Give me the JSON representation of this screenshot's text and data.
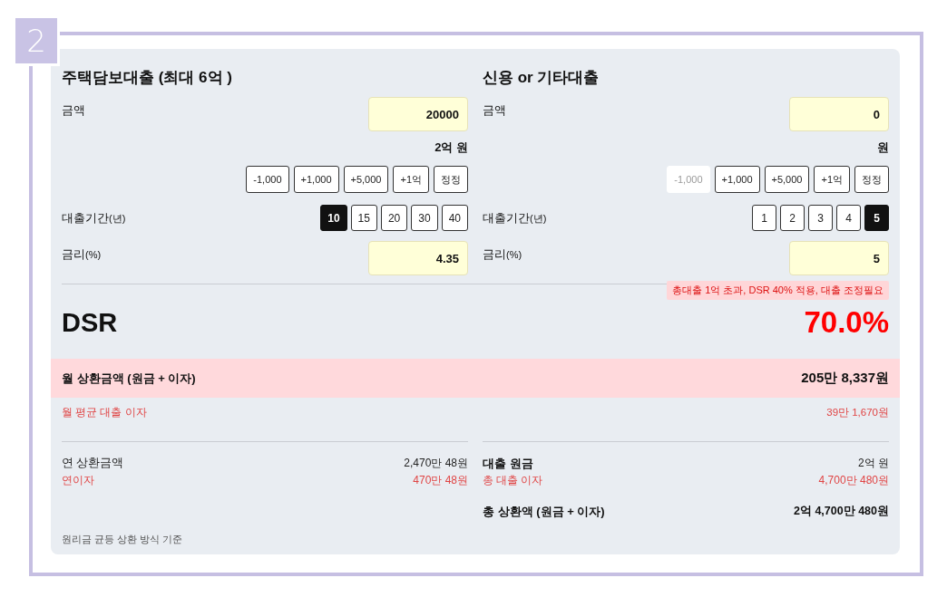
{
  "step_badge": "2",
  "loans": [
    {
      "title": "주택담보대출 (최대 6억 )",
      "amount": {
        "label": "금액",
        "value": "20000",
        "display": "2억 원"
      },
      "adjust_buttons": [
        {
          "label": "-1,000",
          "disabled": false
        },
        {
          "label": "+1,000",
          "disabled": false
        },
        {
          "label": "+5,000",
          "disabled": false
        },
        {
          "label": "+1억",
          "disabled": false
        },
        {
          "label": "정정",
          "disabled": false
        }
      ],
      "term": {
        "label": "대출기간",
        "unit": "(년)",
        "options": [
          {
            "label": "10",
            "selected": true
          },
          {
            "label": "15",
            "selected": false
          },
          {
            "label": "20",
            "selected": false
          },
          {
            "label": "30",
            "selected": false
          },
          {
            "label": "40",
            "selected": false
          }
        ]
      },
      "rate": {
        "label": "금리",
        "unit": "(%)",
        "value": "4.35"
      }
    },
    {
      "title": "신용 or 기타대출",
      "amount": {
        "label": "금액",
        "value": "0",
        "display": "원"
      },
      "adjust_buttons": [
        {
          "label": "-1,000",
          "disabled": true
        },
        {
          "label": "+1,000",
          "disabled": false
        },
        {
          "label": "+5,000",
          "disabled": false
        },
        {
          "label": "+1억",
          "disabled": false
        },
        {
          "label": "정정",
          "disabled": false
        }
      ],
      "term": {
        "label": "대출기간",
        "unit": "(년)",
        "options": [
          {
            "label": "1",
            "selected": false
          },
          {
            "label": "2",
            "selected": false
          },
          {
            "label": "3",
            "selected": false
          },
          {
            "label": "4",
            "selected": false
          },
          {
            "label": "5",
            "selected": true
          }
        ]
      },
      "rate": {
        "label": "금리",
        "unit": "(%)",
        "value": "5"
      }
    }
  ],
  "warning": "총대출 1억 초과, DSR 40% 적용, 대출 조정필요",
  "dsr": {
    "label": "DSR",
    "value": "70.0%"
  },
  "monthly_payment": {
    "label": "월 상환금액 (원금 + 이자)",
    "value": "205만 8,337원"
  },
  "monthly_interest": {
    "label": "월 평균 대출 이자",
    "value": "39만 1,670원"
  },
  "summary": {
    "columns": [
      [
        {
          "kind": "plain",
          "label": "연 상환금액",
          "value": "2,470만 48원"
        },
        {
          "kind": "interest",
          "label": "연이자",
          "value": "470만 48원"
        }
      ],
      [
        {
          "kind": "heading",
          "label": "대출 원금",
          "value": "2억 원"
        },
        {
          "kind": "interest",
          "label": "총 대출 이자",
          "value": "4,700만 480원"
        },
        {
          "kind": "total",
          "label": "총 상환액 (원금 + 이자)",
          "value": "2억 4,700만 480원"
        }
      ]
    ]
  },
  "footnote": "원리금 균등 상환 방식 기준"
}
